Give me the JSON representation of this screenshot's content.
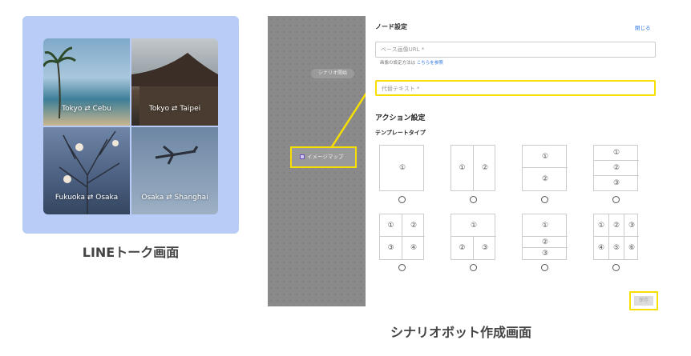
{
  "line_screen": {
    "caption": "LINEトーク画面",
    "menu_cells": [
      {
        "label": "Tokyo ⇄ Cebu"
      },
      {
        "label": "Tokyo ⇄ Taipei"
      },
      {
        "label": "Fukuoka ⇄ Osaka"
      },
      {
        "label": "Osaka ⇄ Shanghai"
      }
    ]
  },
  "bot_screen": {
    "caption": "シナリオボット作成画面",
    "canvas": {
      "start_node": "シナリオ開始",
      "imagemap_node": "イメージマップ"
    },
    "node_settings": {
      "title": "ノード設定",
      "close_label": "閉じる",
      "base_image_url_placeholder": "ベース画像URL *",
      "help_text": "画像の設定方法は",
      "help_link": "こちらを参照",
      "alt_text_placeholder": "代替テキスト *"
    },
    "action_settings": {
      "title": "アクション設定",
      "template_type_label": "テンプレートタイプ",
      "templates": [
        {
          "cells": [
            "①"
          ]
        },
        {
          "cells": [
            "①",
            "②"
          ]
        },
        {
          "cells": [
            "①",
            "②"
          ]
        },
        {
          "cells": [
            "①",
            "②",
            "③"
          ]
        },
        {
          "cells": [
            "①",
            "②",
            "③",
            "④"
          ]
        },
        {
          "cells": [
            "①",
            "②",
            "③"
          ]
        },
        {
          "cells": [
            "①",
            "②",
            "③"
          ]
        },
        {
          "cells": [
            "①",
            "②",
            "③",
            "④",
            "⑤",
            "⑥"
          ]
        }
      ]
    },
    "save_label": "保存"
  },
  "colors": {
    "highlight": "#f7e000",
    "panel_bg": "#b9ccf7",
    "link": "#2a74e0"
  }
}
